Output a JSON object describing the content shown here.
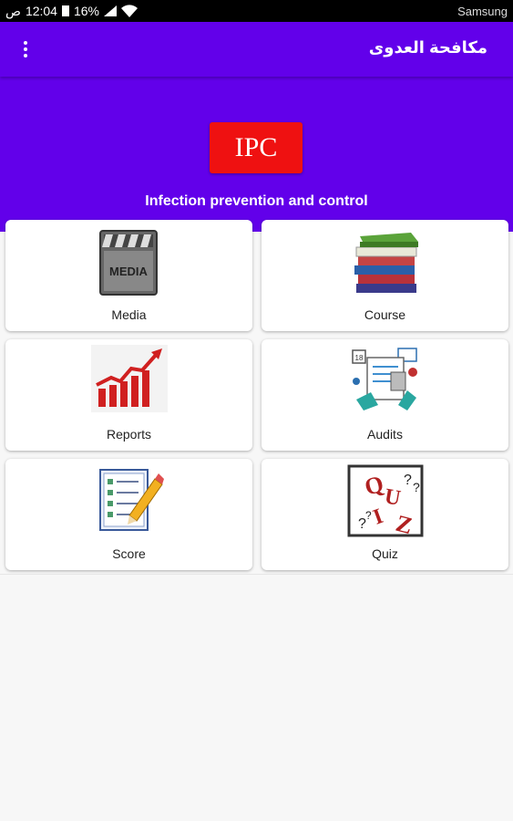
{
  "status_bar": {
    "time": "12:04",
    "ampm": "ص",
    "battery": "16%",
    "carrier": "Samsung"
  },
  "app_bar": {
    "title": "مكافحة العدوى",
    "menu_icon": "more-vert-icon"
  },
  "header": {
    "logo_text": "IPC",
    "subtitle": "Infection prevention and control"
  },
  "tiles": [
    {
      "label": "Media",
      "icon": "media-clapperboard-icon"
    },
    {
      "label": "Course",
      "icon": "books-stack-icon"
    },
    {
      "label": "Reports",
      "icon": "bar-chart-growth-icon"
    },
    {
      "label": "Audits",
      "icon": "audit-checklist-icon"
    },
    {
      "label": "Score",
      "icon": "checklist-pencil-icon"
    },
    {
      "label": "Quiz",
      "icon": "quiz-icon"
    }
  ],
  "colors": {
    "primary": "#6200ea",
    "logo_red": "#ef1111"
  }
}
